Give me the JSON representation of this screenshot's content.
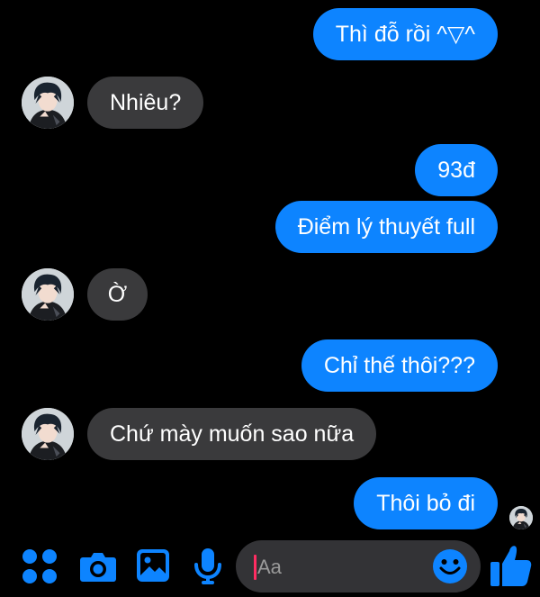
{
  "conversation": {
    "messages": [
      {
        "from": "me",
        "text": "Thì đỗ rồi ^▽^"
      },
      {
        "from": "them",
        "text": "Nhiêu?"
      },
      {
        "from": "me",
        "text": "93đ"
      },
      {
        "from": "me",
        "text": "Điểm lý thuyết full"
      },
      {
        "from": "them",
        "text": "Ờ"
      },
      {
        "from": "me",
        "text": "Chỉ thế thôi???"
      },
      {
        "from": "them",
        "text": "Chứ mày muốn sao nữa"
      },
      {
        "from": "me",
        "text": "Thôi bỏ đi"
      }
    ]
  },
  "composer": {
    "placeholder": "Aa",
    "icons": [
      "apps-icon",
      "camera-icon",
      "gallery-icon",
      "microphone-icon",
      "emoji-icon",
      "thumbs-up-icon"
    ]
  },
  "colors": {
    "background": "#000000",
    "outgoing_bubble": "#0d84ff",
    "incoming_bubble": "#3a3a3c",
    "accent": "#0d84ff",
    "caret": "#ff2d62"
  }
}
